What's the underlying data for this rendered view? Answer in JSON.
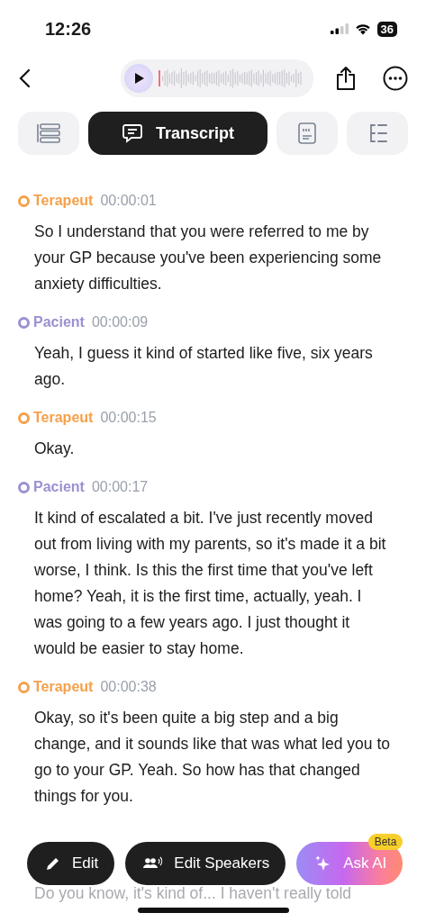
{
  "status_bar": {
    "time": "12:26",
    "battery": "36"
  },
  "tabs": [
    {
      "kind": "outline",
      "selected": false
    },
    {
      "kind": "transcript",
      "label": "Transcript",
      "selected": true
    },
    {
      "kind": "quote",
      "selected": false
    },
    {
      "kind": "mindmap",
      "selected": false
    }
  ],
  "segments": [
    {
      "speaker": "Terapeut",
      "color": "#f5a04a",
      "time": "00:00:01",
      "text": "So I understand that you were referred to me by your GP because you've been experiencing some anxiety difficulties."
    },
    {
      "speaker": "Pacient",
      "color": "#9c8fd2",
      "time": "00:00:09",
      "text": "Yeah, I guess it kind of started like five, six years ago."
    },
    {
      "speaker": "Terapeut",
      "color": "#f5a04a",
      "time": "00:00:15",
      "text": "Okay."
    },
    {
      "speaker": "Pacient",
      "color": "#9c8fd2",
      "time": "00:00:17",
      "text": "It kind of escalated a bit. I've just recently moved out from living with my parents, so it's made it a bit worse, I think. Is this the first time that you've left home? Yeah, it is the first time, actually, yeah. I was going to a few years ago. I just thought it would be easier to stay home."
    },
    {
      "speaker": "Terapeut",
      "color": "#f5a04a",
      "time": "00:00:38",
      "text": "Okay, so it's been quite a big step and a big change, and it sounds like that was what led you to go to your GP. Yeah. So how has that changed things for you."
    }
  ],
  "faded_text": "Do you know, it's kind of... I haven't really told",
  "actions": [
    {
      "kind": "edit",
      "label": "Edit"
    },
    {
      "kind": "speakers",
      "label": "Edit Speakers"
    },
    {
      "kind": "ai",
      "label": "Ask AI",
      "badge": "Beta"
    }
  ]
}
